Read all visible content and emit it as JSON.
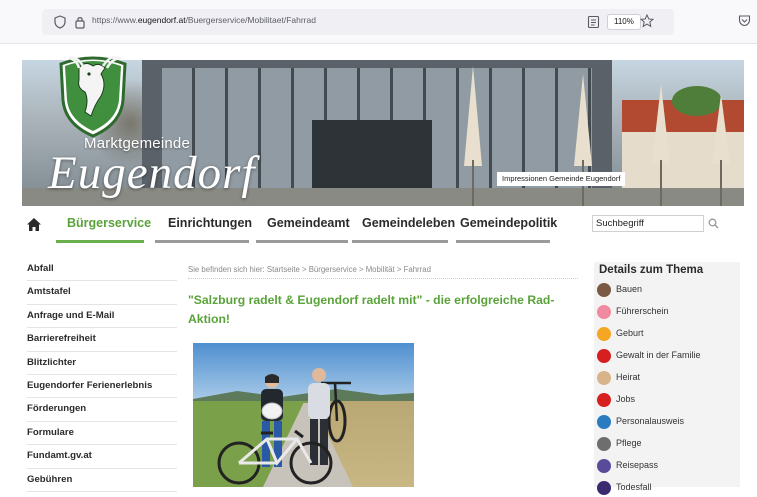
{
  "browser": {
    "url_prefix": "https://www.",
    "url_domain": "eugendorf.at",
    "url_path": "/Buergerservice/Mobilitaet/Fahrrad",
    "zoom": "110%"
  },
  "header": {
    "brand_small": "Marktgemeinde",
    "brand_big": "Eugendorf",
    "caption": "Impressionen Gemeinde Eugendorf"
  },
  "nav": {
    "items": [
      {
        "label": "Bürgerservice"
      },
      {
        "label": "Einrichtungen"
      },
      {
        "label": "Gemeindeamt"
      },
      {
        "label": "Gemeindeleben"
      },
      {
        "label": "Gemeindepolitik"
      }
    ],
    "search_placeholder": "Suchbegriff"
  },
  "sidebar": {
    "items": [
      {
        "label": "Abfall"
      },
      {
        "label": "Amtstafel"
      },
      {
        "label": "Anfrage und E-Mail"
      },
      {
        "label": "Barrierefreiheit"
      },
      {
        "label": "Blitzlichter"
      },
      {
        "label": "Eugendorfer Ferienerlebnis"
      },
      {
        "label": "Förderungen"
      },
      {
        "label": "Formulare"
      },
      {
        "label": "Fundamt.gv.at"
      },
      {
        "label": "Gebühren"
      }
    ]
  },
  "main": {
    "breadcrumb": "Sie befinden sich hier: Startseite > Bürgerservice > Mobilität > Fahrrad",
    "title": "\"Salzburg radelt & Eugendorf radelt mit\" - die erfolgreiche Rad-Aktion!"
  },
  "details": {
    "title": "Details zum Thema",
    "items": [
      {
        "label": "Bauen",
        "color": "#7a5a45"
      },
      {
        "label": "Führerschein",
        "color": "#f08aa0"
      },
      {
        "label": "Geburt",
        "color": "#f5a623"
      },
      {
        "label": "Gewalt in der Familie",
        "color": "#d62020"
      },
      {
        "label": "Heirat",
        "color": "#d8b48a"
      },
      {
        "label": "Jobs",
        "color": "#d62020"
      },
      {
        "label": "Personalausweis",
        "color": "#2a7bc0"
      },
      {
        "label": "Pflege",
        "color": "#6e6e6e"
      },
      {
        "label": "Reisepass",
        "color": "#5a4a9a"
      },
      {
        "label": "Todesfall",
        "color": "#3a2a70"
      }
    ]
  },
  "colors": {
    "accent_green": "#5aa33a",
    "nav_inactive_underline": "#9a9a9a"
  }
}
